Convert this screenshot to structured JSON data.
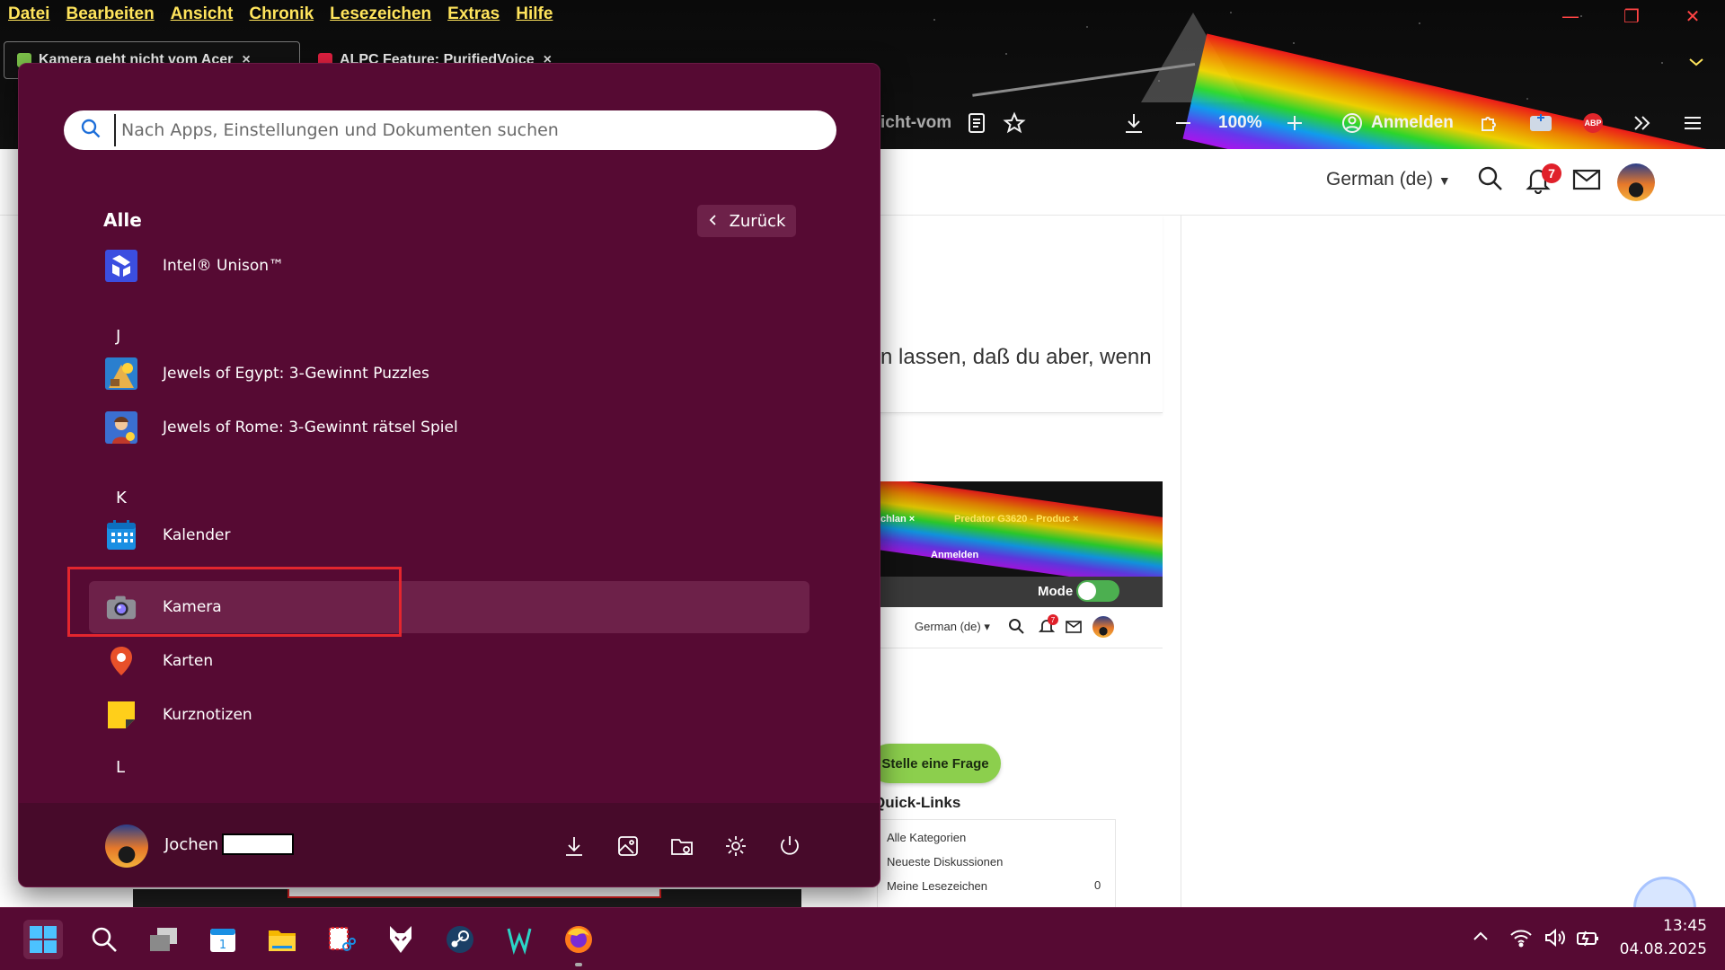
{
  "browser": {
    "menu": [
      "Datei",
      "Bearbeiten",
      "Ansicht",
      "Chronik",
      "Lesezeichen",
      "Extras",
      "Hilfe"
    ],
    "tabs": [
      {
        "title": "Kamera geht nicht vom Acer",
        "close": "×",
        "favicon_color": "#7cc24a",
        "active": true
      },
      {
        "title": "ALPC Feature: PurifiedVoice",
        "close": "×",
        "favicon_color": "#e02040",
        "active": false
      }
    ],
    "address_fragment": "icht-vom",
    "zoom": "100%",
    "signin_label": "Anmelden",
    "abp_label": "ABP",
    "window_controls": {
      "minimize": "—",
      "restore": "❐",
      "close": "✕"
    }
  },
  "site": {
    "language": "German (de)",
    "notification_count": "7",
    "post_text": "n lassen, daß du aber, wenn",
    "screenshot": {
      "tab_text_1": "chlan ×",
      "tab_text_2": "Predator G3620 - Produc ×",
      "signin": "Anmelden",
      "mode_label": "Mode",
      "language": "German (de)",
      "badge": "7"
    },
    "ask_button": "Stelle eine Frage",
    "quicklinks_title": "Quick-Links",
    "quicklinks": [
      "Alle Kategorien",
      "Neueste Diskussionen",
      "Meine Lesezeichen"
    ],
    "bookmark_count": "0"
  },
  "start_menu": {
    "search_placeholder": "Nach Apps, Einstellungen und Dokumenten suchen",
    "section_title": "Alle",
    "back_label": "Zurück",
    "letters": [
      "J",
      "K",
      "L"
    ],
    "apps": [
      {
        "name": "Intel® Unison™",
        "icon": "intel-unison-icon"
      },
      {
        "name": "Jewels of Egypt: 3-Gewinnt Puzzles",
        "icon": "jewels-egypt-icon"
      },
      {
        "name": "Jewels of Rome: 3-Gewinnt rätsel Spiel",
        "icon": "jewels-rome-icon"
      },
      {
        "name": "Kalender",
        "icon": "calendar-icon"
      },
      {
        "name": "Kamera",
        "icon": "camera-icon",
        "selected": true
      },
      {
        "name": "Karten",
        "icon": "maps-icon"
      },
      {
        "name": "Kurznotizen",
        "icon": "sticky-notes-icon"
      }
    ],
    "user": {
      "name": "Jochen"
    },
    "footer_icons": [
      "download-icon",
      "pictures-icon",
      "file-explorer-icon",
      "settings-icon",
      "power-icon"
    ]
  },
  "taskbar": {
    "time": "13:45",
    "date": "04.08.2025",
    "apps": [
      "start-icon",
      "search-icon",
      "task-view-icon",
      "calendar-icon",
      "file-explorer-icon",
      "snipping-tool-icon",
      "falkon-icon",
      "steam-icon",
      "predator-sense-icon",
      "firefox-icon"
    ],
    "tray": [
      "chevron-up-icon",
      "wifi-icon",
      "volume-icon",
      "battery-icon"
    ]
  },
  "colors": {
    "start_bg": "#560a33",
    "start_footer": "#470a2a",
    "selected_row": "#6d2149",
    "highlight_box": "#e3262e",
    "menu_text": "#ffe45c"
  }
}
